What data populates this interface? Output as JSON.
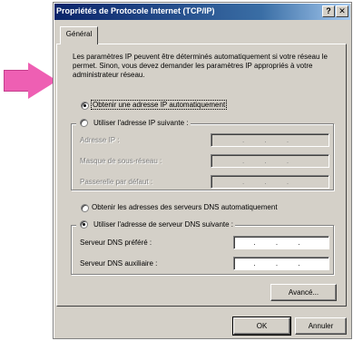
{
  "window": {
    "title": "Propriétés de Protocole Internet (TCP/IP)",
    "help_btn": "?",
    "close_btn": "✕"
  },
  "tabs": [
    {
      "label": "Général"
    }
  ],
  "intro": "Les paramètres IP peuvent être déterminés automatiquement si votre réseau le permet. Sinon, vous devez demander les paramètres IP appropriés à votre administrateur réseau.",
  "ip": {
    "auto_label": "Obtenir une adresse IP automatiquement",
    "manual_label": "Utiliser l'adresse IP suivante :",
    "fields": [
      {
        "label": "Adresse IP :",
        "value": ". . ."
      },
      {
        "label": "Masque de sous-réseau :",
        "value": ". . ."
      },
      {
        "label": "Passerelle par défaut :",
        "value": ". . ."
      }
    ]
  },
  "dns": {
    "auto_label": "Obtenir les adresses des serveurs DNS automatiquement",
    "manual_label": "Utiliser l'adresse de serveur DNS suivante :",
    "fields": [
      {
        "label": "Serveur DNS préféré :",
        "value": ". . ."
      },
      {
        "label": "Serveur DNS auxiliaire :",
        "value": ". . ."
      }
    ]
  },
  "buttons": {
    "advanced": "Avancé...",
    "ok": "OK",
    "cancel": "Annuler"
  },
  "colors": {
    "arrow": "#ee5fb3",
    "titlebar_start": "#0a246a",
    "dialog_bg": "#d4d0c8"
  }
}
